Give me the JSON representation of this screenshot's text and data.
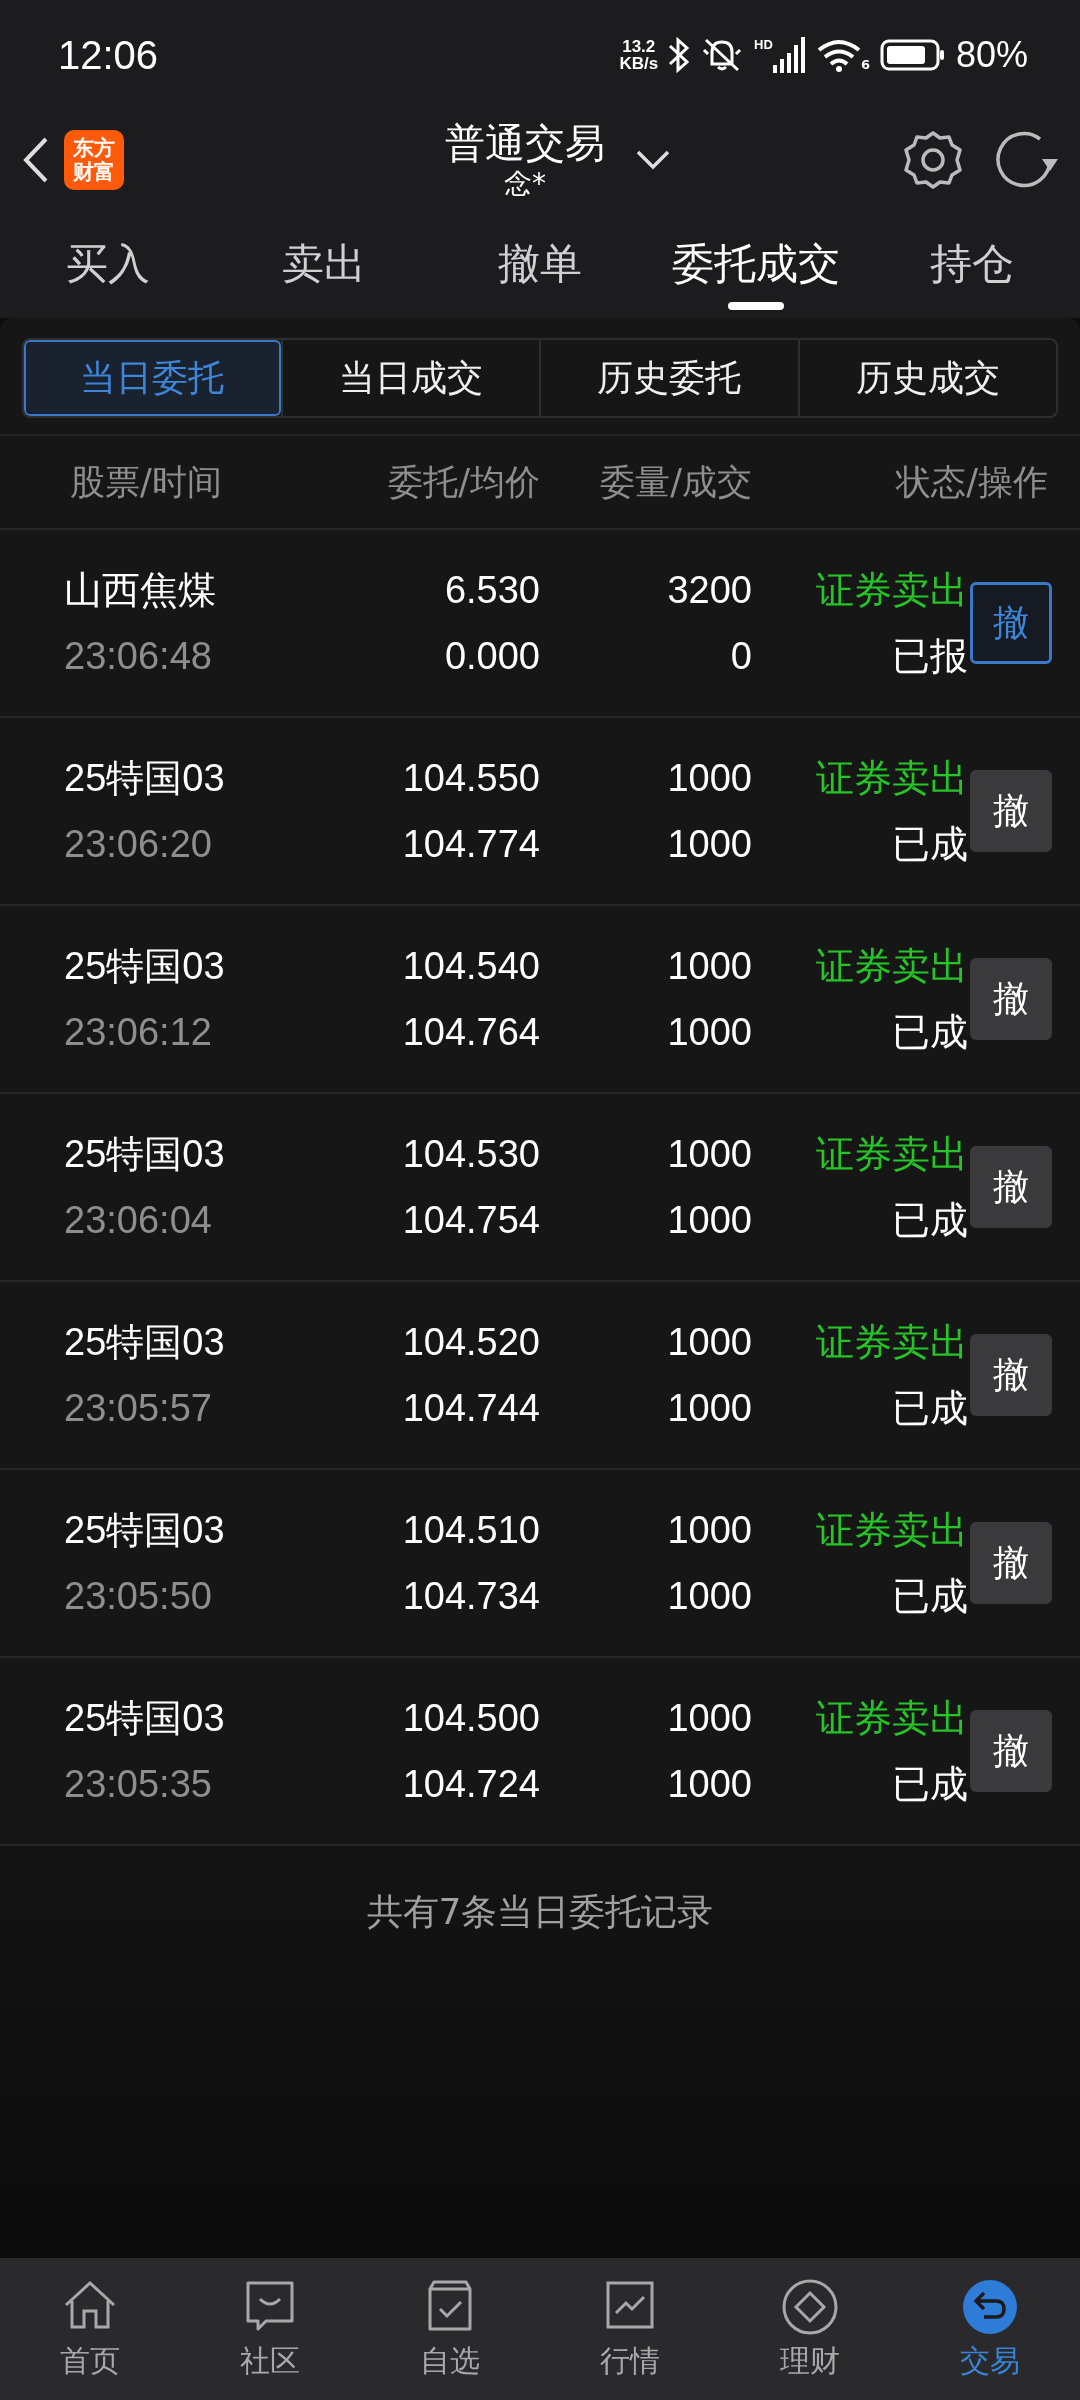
{
  "status_bar": {
    "time": "12:06",
    "net_speed": "13.2",
    "net_unit": "KB/s",
    "signal_label": "HD",
    "wifi_label": "6",
    "battery": "80%"
  },
  "header": {
    "logo_lines": [
      "东方",
      "财富"
    ],
    "title": "普通交易",
    "account": "念*"
  },
  "tabs": [
    {
      "label": "买入",
      "selected": false
    },
    {
      "label": "卖出",
      "selected": false
    },
    {
      "label": "撤单",
      "selected": false
    },
    {
      "label": "委托成交",
      "selected": true
    },
    {
      "label": "持仓",
      "selected": false
    }
  ],
  "sub_tabs": [
    {
      "label": "当日委托",
      "selected": true
    },
    {
      "label": "当日成交",
      "selected": false
    },
    {
      "label": "历史委托",
      "selected": false
    },
    {
      "label": "历史成交",
      "selected": false
    }
  ],
  "table": {
    "columns": [
      "股票/时间",
      "委托/均价",
      "委量/成交",
      "状态/操作"
    ],
    "rows": [
      {
        "name": "山西焦煤",
        "time": "23:06:48",
        "price": "6.530",
        "avg_price": "0.000",
        "quantity": "3200",
        "filled": "0",
        "action": "证券卖出",
        "status": "已报",
        "cancel": "撤",
        "cancellable": true
      },
      {
        "name": "25特国03",
        "time": "23:06:20",
        "price": "104.550",
        "avg_price": "104.774",
        "quantity": "1000",
        "filled": "1000",
        "action": "证券卖出",
        "status": "已成",
        "cancel": "撤",
        "cancellable": false
      },
      {
        "name": "25特国03",
        "time": "23:06:12",
        "price": "104.540",
        "avg_price": "104.764",
        "quantity": "1000",
        "filled": "1000",
        "action": "证券卖出",
        "status": "已成",
        "cancel": "撤",
        "cancellable": false
      },
      {
        "name": "25特国03",
        "time": "23:06:04",
        "price": "104.530",
        "avg_price": "104.754",
        "quantity": "1000",
        "filled": "1000",
        "action": "证券卖出",
        "status": "已成",
        "cancel": "撤",
        "cancellable": false
      },
      {
        "name": "25特国03",
        "time": "23:05:57",
        "price": "104.520",
        "avg_price": "104.744",
        "quantity": "1000",
        "filled": "1000",
        "action": "证券卖出",
        "status": "已成",
        "cancel": "撤",
        "cancellable": false
      },
      {
        "name": "25特国03",
        "time": "23:05:50",
        "price": "104.510",
        "avg_price": "104.734",
        "quantity": "1000",
        "filled": "1000",
        "action": "证券卖出",
        "status": "已成",
        "cancel": "撤",
        "cancellable": false
      },
      {
        "name": "25特国03",
        "time": "23:05:35",
        "price": "104.500",
        "avg_price": "104.724",
        "quantity": "1000",
        "filled": "1000",
        "action": "证券卖出",
        "status": "已成",
        "cancel": "撤",
        "cancellable": false
      }
    ]
  },
  "summary": "共有7条当日委托记录",
  "bottom_nav": [
    {
      "label": "首页",
      "kind": "home",
      "selected": false
    },
    {
      "label": "社区",
      "kind": "community",
      "selected": false
    },
    {
      "label": "自选",
      "kind": "watchlist",
      "selected": false
    },
    {
      "label": "行情",
      "kind": "market",
      "selected": false
    },
    {
      "label": "理财",
      "kind": "finance",
      "selected": false
    },
    {
      "label": "交易",
      "kind": "trade",
      "selected": true
    }
  ]
}
